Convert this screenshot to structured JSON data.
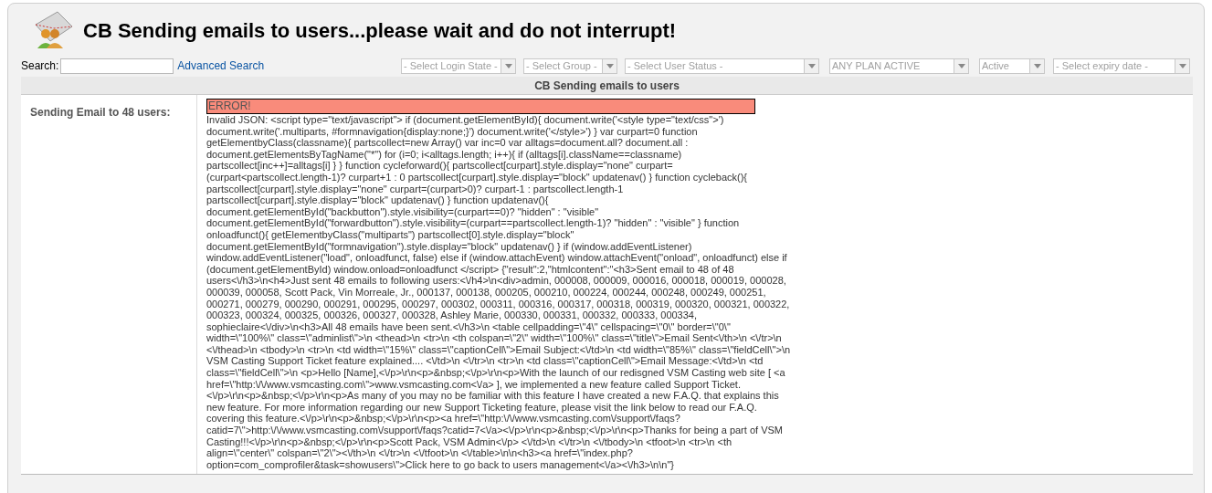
{
  "title": "CB Sending emails to users...please wait and do not interrupt!",
  "search": {
    "label": "Search:",
    "link": "Advanced Search"
  },
  "filters": [
    {
      "value": "- Select Login State -",
      "kind": "placeholder"
    },
    {
      "value": "- Select Group -",
      "kind": "placeholder"
    },
    {
      "value": "- Select User Status -",
      "kind": "placeholder"
    },
    {
      "value": "ANY PLAN ACTIVE",
      "kind": "placeholder"
    },
    {
      "value": "Active",
      "kind": "placeholder"
    },
    {
      "value": "- Select expiry date -",
      "kind": "placeholder"
    }
  ],
  "table": {
    "heading": "CB Sending emails to users",
    "row": {
      "label": "Sending Email to 48 users:",
      "error_title": "ERROR!",
      "error_message": "Invalid JSON: <script type=\"text/javascript\"> if (document.getElementById){ document.write('<style type=\"text/css\">') document.write('.multiparts, #formnavigation{display:none;}') document.write('</style>') } var curpart=0 function getElementbyClass(classname){ partscollect=new Array() var inc=0 var alltags=document.all? document.all : document.getElementsByTagName(\"*\") for (i=0; i<alltags.length; i++){ if (alltags[i].className==classname) partscollect[inc++]=alltags[i] } } function cycleforward(){ partscollect[curpart].style.display=\"none\" curpart=(curpart<partscollect.length-1)? curpart+1 : 0 partscollect[curpart].style.display=\"block\" updatenav() } function cycleback(){ partscollect[curpart].style.display=\"none\" curpart=(curpart>0)? curpart-1 : partscollect.length-1 partscollect[curpart].style.display=\"block\" updatenav() } function updatenav(){ document.getElementById(\"backbutton\").style.visibility=(curpart==0)? \"hidden\" : \"visible\" document.getElementById(\"forwardbutton\").style.visibility=(curpart==partscollect.length-1)? \"hidden\" : \"visible\" } function onloadfunct(){ getElementbyClass(\"multiparts\") partscollect[0].style.display=\"block\" document.getElementById(\"formnavigation\").style.display=\"block\" updatenav() } if (window.addEventListener) window.addEventListener(\"load\", onloadfunct, false) else if (window.attachEvent) window.attachEvent(\"onload\", onloadfunct) else if (document.getElementById) window.onload=onloadfunct </script> {\"result\":2,\"htmlcontent\":\"<h3>Sent email to 48 of 48 users<\\/h3>\\n<h4>Just sent 48 emails to following users:<\\/h4>\\n<div>admin, 000008, 000009, 000016, 000018, 000019, 000028, 000039, 000058, Scott Pack, Vin Morreale, Jr., 000137, 000138, 000205, 000210, 000224, 000244, 000248, 000249, 000251, 000271, 000279, 000290, 000291, 000295, 000297, 000302, 000311, 000316, 000317, 000318, 000319, 000320, 000321, 000322, 000323, 000324, 000325, 000326, 000327, 000328, Ashley Marie, 000330, 000331, 000332, 000333, 000334, sophieclaire<\\/div>\\n<h3>All 48 emails have been sent.<\\/h3>\\n <table cellpadding=\\\"4\\\" cellspacing=\\\"0\\\" border=\\\"0\\\" width=\\\"100%\\\" class=\\\"adminlist\\\">\\n <thead>\\n <tr>\\n <th colspan=\\\"2\\\" width=\\\"100%\\\" class=\\\"title\\\">Email Sent<\\/th>\\n <\\/tr>\\n <\\/thead>\\n <tbody>\\n <tr>\\n <td width=\\\"15%\\\" class=\\\"captionCell\\\">Email Subject:<\\/td>\\n <td width=\\\"85%\\\" class=\\\"fieldCell\\\">\\n VSM Casting Support Ticket feature explained.... <\\/td>\\n <\\/tr>\\n <tr>\\n <td class=\\\"captionCell\\\">Email Message:<\\/td>\\n <td class=\\\"fieldCell\\\">\\n <p>Hello [Name],<\\/p>\\r\\n<p>&nbsp;<\\/p>\\r\\n<p>With the launch of our redisgned VSM Casting web site [ <a href=\\\"http:\\/\\/www.vsmcasting.com\\\">www.vsmcasting.com<\\/a> ], we implemented a new feature called Support Ticket.<\\/p>\\r\\n<p>&nbsp;<\\/p>\\r\\n<p>As many of you may no be familiar with this feature I have created a new F.A.Q. that explains this new feature. For more information regarding our new Support Ticketing feature, please visit the link below to read our F.A.Q. covering this feature.<\\/p>\\r\\n<p>&nbsp;<\\/p>\\r\\n<p><a href=\\\"http:\\/\\/www.vsmcasting.com\\/support\\/faqs?catid=7\\\">http:\\/\\/www.vsmcasting.com\\/support\\/faqs?catid=7<\\/a><\\/p>\\r\\n<p>&nbsp;<\\/p>\\r\\n<p>Thanks for being a part of VSM Casting!!!<\\/p>\\r\\n<p>&nbsp;<\\/p>\\r\\n<p>Scott Pack, VSM Admin<\\/p> <\\/td>\\n <\\/tr>\\n <\\/tbody>\\n <tfoot>\\n <tr>\\n <th align=\\\"center\\\" colspan=\\\"2\\\"><\\/th>\\n <\\/tr>\\n <\\/tfoot>\\n <\\/table>\\n\\n<h3><a href=\\\"index.php?option=com_comprofiler&task=showusers\\\">Click here to go back to users management<\\/a><\\/h3>\\n\\n\"}"
    }
  }
}
